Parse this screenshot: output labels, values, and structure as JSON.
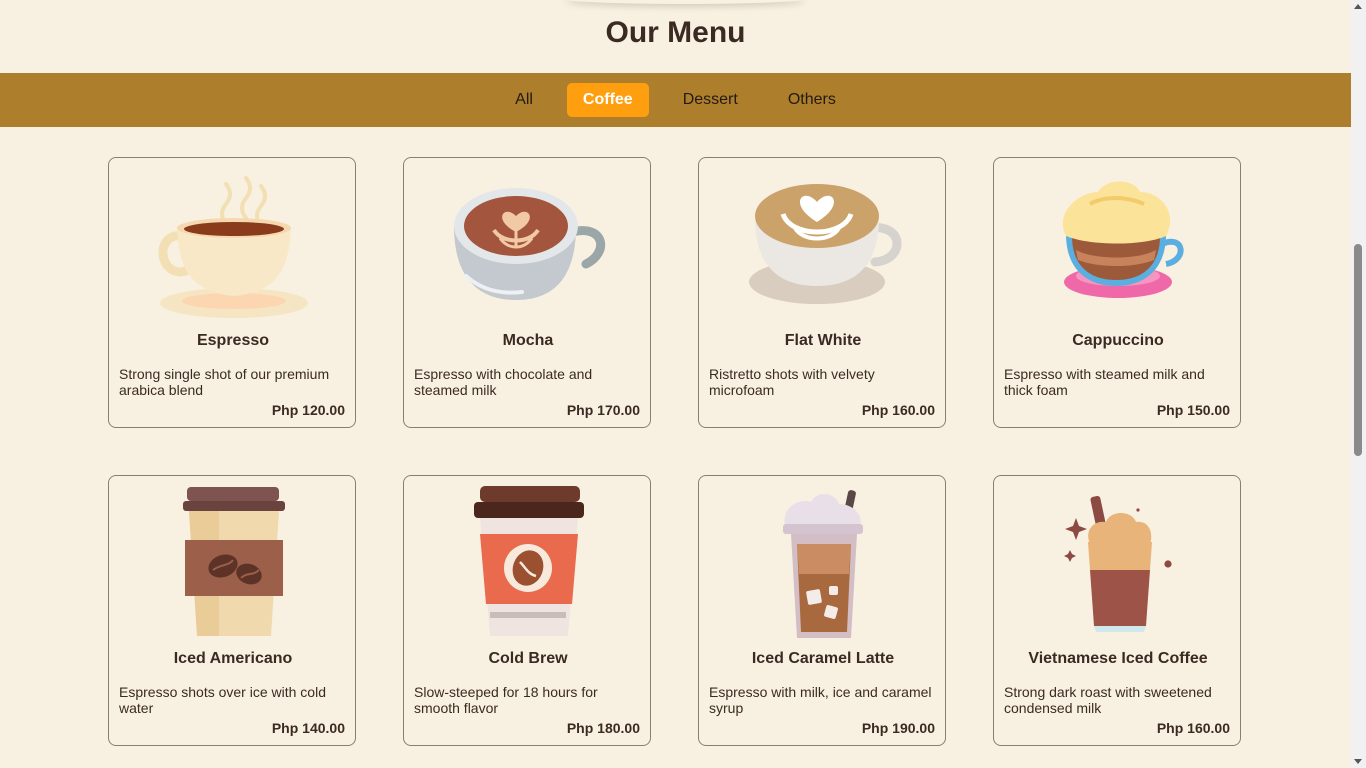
{
  "header": {
    "title": "Our Menu"
  },
  "tabs": [
    {
      "label": "All",
      "active": false
    },
    {
      "label": "Coffee",
      "active": true
    },
    {
      "label": "Dessert",
      "active": false
    },
    {
      "label": "Others",
      "active": false
    }
  ],
  "items": [
    {
      "name": "Espresso",
      "description": "Strong single shot of our premium arabica blend",
      "price": "Php 120.00",
      "icon": "espresso-cup-icon"
    },
    {
      "name": "Mocha",
      "description": "Espresso with chocolate and steamed milk",
      "price": "Php 170.00",
      "icon": "mocha-cup-icon"
    },
    {
      "name": "Flat White",
      "description": "Ristretto shots with velvety microfoam",
      "price": "Php 160.00",
      "icon": "flat-white-cup-icon"
    },
    {
      "name": "Cappuccino",
      "description": "Espresso with steamed milk and thick foam",
      "price": "Php 150.00",
      "icon": "cappuccino-cup-icon"
    },
    {
      "name": "Iced Americano",
      "description": "Espresso shots over ice with cold water",
      "price": "Php 140.00",
      "icon": "iced-americano-cup-icon"
    },
    {
      "name": "Cold Brew",
      "description": "Slow-steeped for 18 hours for smooth flavor",
      "price": "Php 180.00",
      "icon": "cold-brew-cup-icon"
    },
    {
      "name": "Iced Caramel Latte",
      "description": "Espresso with milk, ice and caramel syrup",
      "price": "Php 190.00",
      "icon": "iced-caramel-latte-icon"
    },
    {
      "name": "Vietnamese Iced Coffee",
      "description": "Strong dark roast with sweetened condensed milk",
      "price": "Php 160.00",
      "icon": "vietnamese-iced-coffee-icon"
    }
  ],
  "colors": {
    "background": "#f8f1e1",
    "tabbar": "#ad7f2c",
    "active_tab": "#ff9f0f",
    "text": "#3b2a22"
  }
}
